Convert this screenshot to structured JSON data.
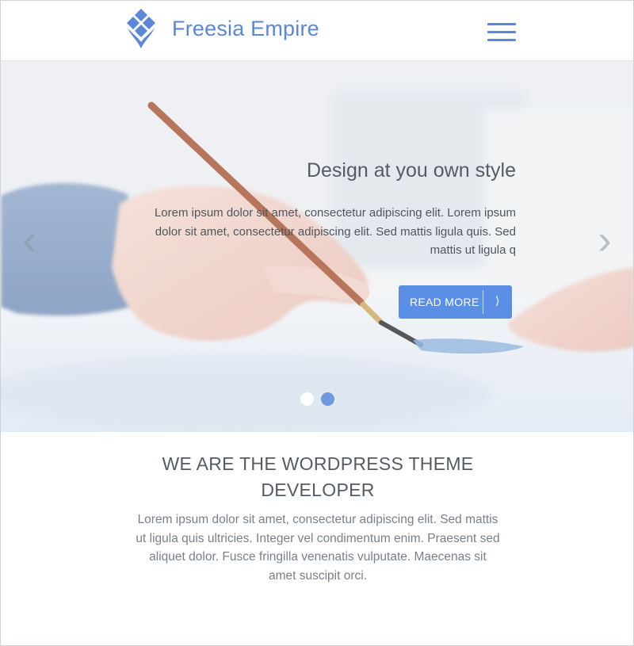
{
  "header": {
    "brand": "Freesia Empire",
    "logo_icon": "diamond-cluster-icon",
    "menu_icon": "hamburger-icon",
    "accent_color": "#5b87d9"
  },
  "slider": {
    "title": "Design at you own style",
    "text": "Lorem ipsum dolor sit amet, consectetur adipiscing elit. Lorem ipsum dolor sit amet, consectetur adipiscing elit. Sed mattis ligula quis. Sed mattis ut ligula q",
    "button_label": "READ MORE",
    "button_icon": "⟩",
    "prev_icon": "‹",
    "next_icon": "›",
    "button_color": "#5b8fe6",
    "active_slide": 2,
    "slide_count": 2
  },
  "intro": {
    "title_line1": "WE ARE THE WORDPRESS THEME",
    "title_line2": "DEVELOPER",
    "text": "Lorem ipsum dolor sit amet, consectetur adipiscing elit. Sed mattis ut ligula quis ultricies. Integer vel condimentum enim. Praesent sed aliquet dolor. Fusce fringilla venenatis vulputate. Maecenas sit amet suscipit orci."
  }
}
